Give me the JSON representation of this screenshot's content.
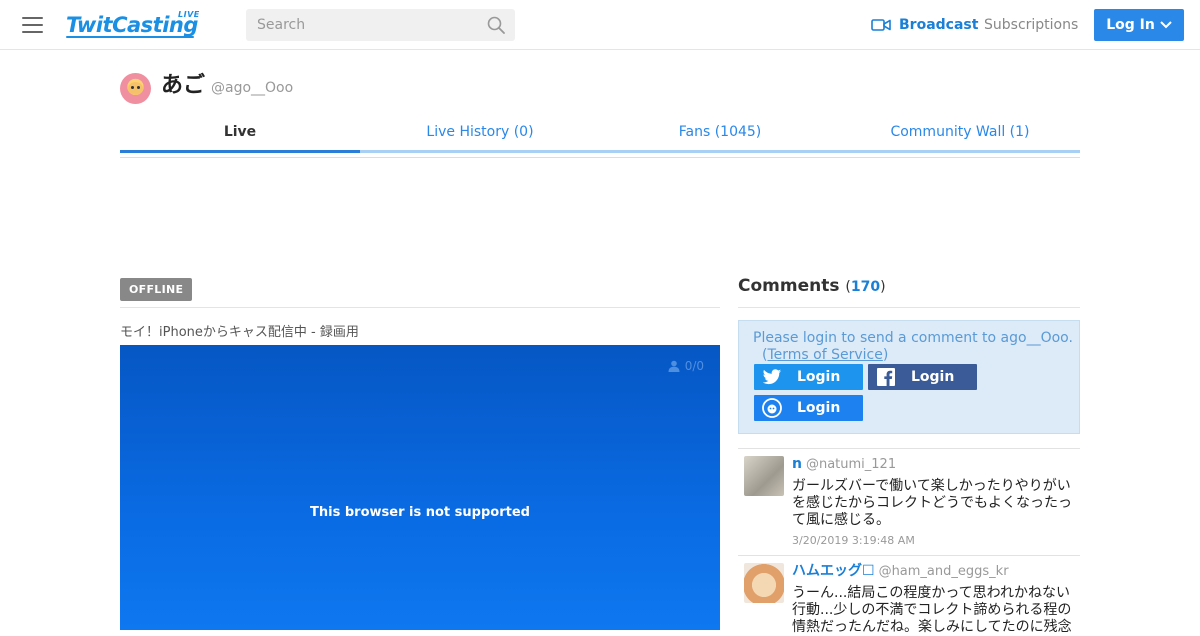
{
  "header": {
    "logo_text": "TwitCasting",
    "logo_live": "LIVE",
    "search_placeholder": "Search",
    "broadcast_label": "Broadcast",
    "subscriptions_label": "Subscriptions",
    "login_label": "Log In",
    "accent_color": "#2a88e8"
  },
  "profile": {
    "display_name": "あご",
    "handle": "@ago__Ooo"
  },
  "tabs": [
    {
      "label": "Live",
      "active": true
    },
    {
      "label": "Live History (0)",
      "active": false
    },
    {
      "label": "Fans (1045)",
      "active": false
    },
    {
      "label": "Community Wall (1)",
      "active": false
    }
  ],
  "live": {
    "status_badge": "OFFLINE",
    "movie_title": "モイ！iPhoneからキャス配信中 - 録画用",
    "viewer_count": "0/0",
    "player_message": "This browser is not supported"
  },
  "comments": {
    "title": "Comments",
    "count_open": "(",
    "count": "170",
    "count_close": ")",
    "login_message": "Please login to send a comment to ago__Ooo.",
    "tos_open": "(",
    "tos_link": "Terms of Service",
    "tos_close": ")",
    "twitter_login": "Login",
    "facebook_login": "Login",
    "twitcasting_login": "Login",
    "items": [
      {
        "name": "n",
        "handle": "@natumi_121",
        "text": "ガールズバーで働いて楽しかったりやりがいを感じたからコレクトどうでもよくなったって風に感じる。",
        "time": "3/20/2019 3:19:48 AM"
      },
      {
        "name": "ハムエッグ☐",
        "handle": "@ham_and_eggs_kr",
        "text": "うーん...結局この程度かって思われかねない行動...少しの不満でコレクト諦められる程の情熱だったんだね。楽しみにしてたのに残念",
        "time": ""
      }
    ]
  }
}
